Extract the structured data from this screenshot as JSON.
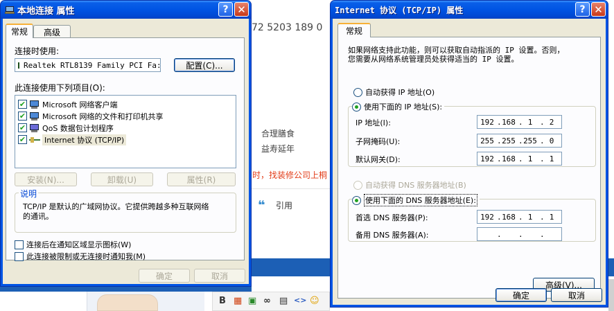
{
  "background": {
    "phone_text": "72 5203   189 0",
    "text_line1": "合理膳食",
    "text_line2": "益寿延年",
    "red_text": "时，找装修公司上桐",
    "quote_icon": "quote-icon",
    "quote_label": "引用",
    "editor_toolbar": [
      "B",
      "▦",
      "▣",
      "∞",
      "▤",
      "<>",
      "☺"
    ]
  },
  "left_window": {
    "title": "本地连接 属性",
    "help_btn": "?",
    "close_btn": "✕",
    "tabs": [
      "常规",
      "高级"
    ],
    "connect_using_label": "连接时使用:",
    "adapter_name": "Realtek RTL8139 Family PCI Fa:",
    "configure_button": "配置(C)...",
    "items_label": "此连接使用下列项目(O):",
    "items": [
      {
        "label": "Microsoft 网络客户端",
        "checked": true,
        "icon": "network-client-icon"
      },
      {
        "label": "Microsoft 网络的文件和打印机共享",
        "checked": true,
        "icon": "file-share-icon"
      },
      {
        "label": "QoS 数据包计划程序",
        "checked": true,
        "icon": "qos-icon"
      },
      {
        "label": "Internet 协议 (TCP/IP)",
        "checked": true,
        "icon": "protocol-icon"
      }
    ],
    "install_button": "安装(N)...",
    "uninstall_button": "卸载(U)",
    "properties_button": "属性(R)",
    "description_title": "说明",
    "description_text_line1": "TCP/IP 是默认的广域网协议。它提供跨越多种互联网络",
    "description_text_line2": "的通讯。",
    "show_icon_label": "连接后在通知区域显示图标(W)",
    "notify_label": "此连接被限制或无连接时通知我(M)",
    "ok_button": "确定",
    "cancel_button": "取消"
  },
  "right_window": {
    "title": "Internet 协议 (TCP/IP) 属性",
    "help_btn": "?",
    "close_btn": "✕",
    "tab": "常规",
    "intro_line1": "如果网络支持此功能，则可以获取自动指派的 IP 设置。否则，",
    "intro_line2": "您需要从网络系统管理员处获得适当的 IP 设置。",
    "auto_ip_label": "自动获得 IP 地址(O)",
    "manual_ip_label": "使用下面的 IP 地址(S):",
    "ip_label": "IP 地址(I):",
    "ip_address": [
      "192",
      "168",
      "1",
      "2"
    ],
    "subnet_label": "子网掩码(U):",
    "subnet_mask": [
      "255",
      "255",
      "255",
      "0"
    ],
    "gateway_label": "默认网关(D):",
    "gateway": [
      "192",
      "168",
      "1",
      "1"
    ],
    "auto_dns_label": "自动获得 DNS 服务器地址(B)",
    "manual_dns_label": "使用下面的 DNS 服务器地址(E):",
    "preferred_dns_label": "首选 DNS 服务器(P):",
    "preferred_dns": [
      "192",
      "168",
      "1",
      "1"
    ],
    "alternate_dns_label": "备用 DNS 服务器(A):",
    "alternate_dns": [
      "",
      "",
      "",
      ""
    ],
    "advanced_button": "高级(V)...",
    "ok_button": "确定",
    "cancel_button": "取消"
  }
}
